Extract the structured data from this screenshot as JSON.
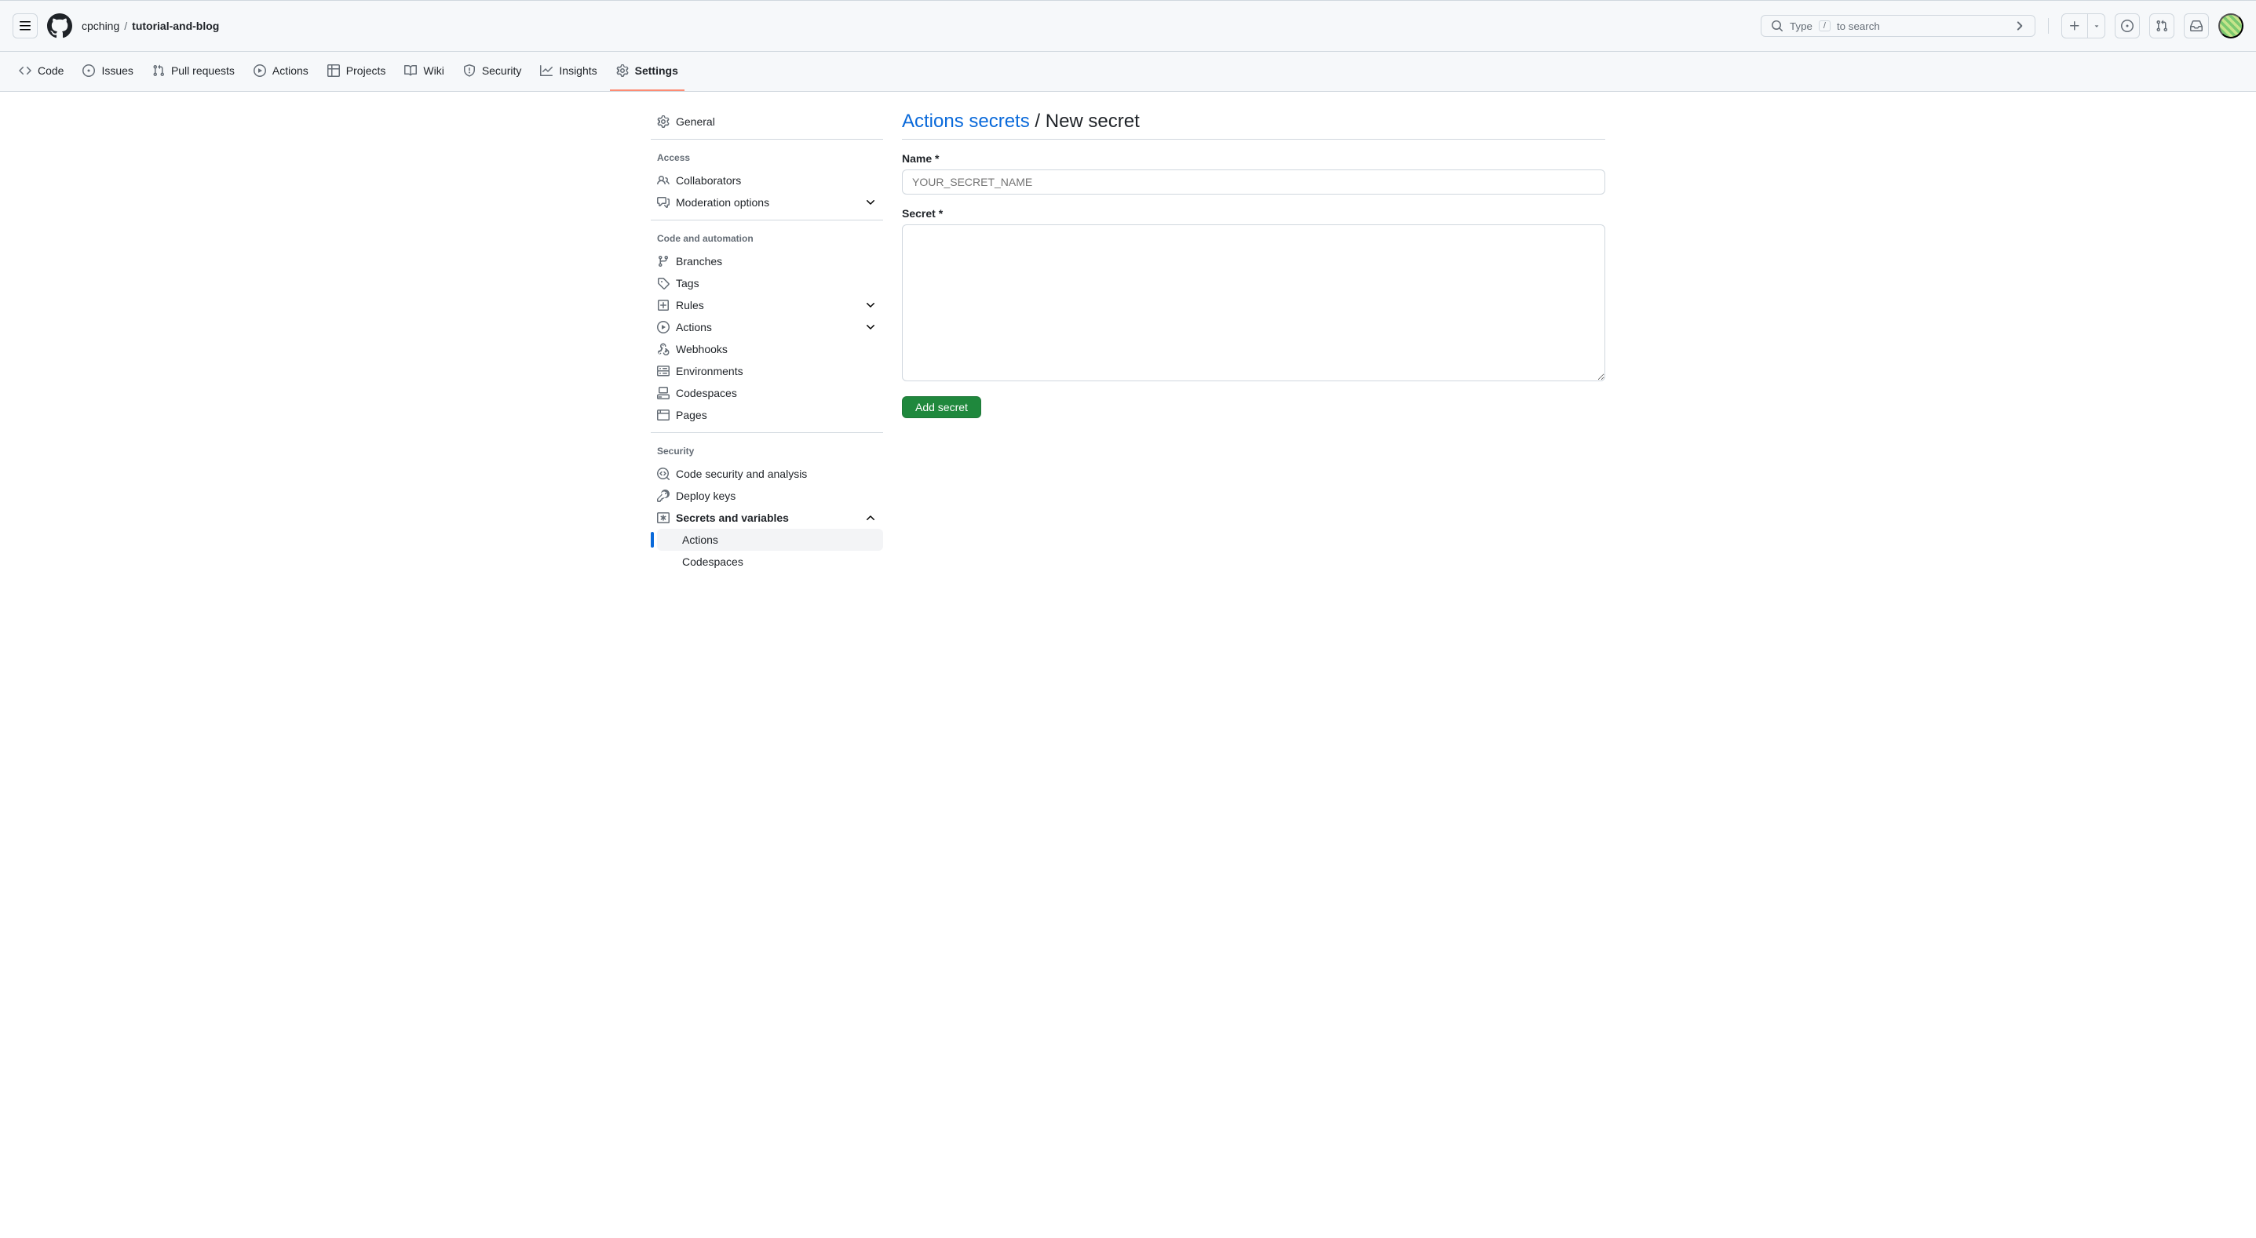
{
  "header": {
    "owner": "cpching",
    "repo": "tutorial-and-blog",
    "search_prompt_prefix": "Type ",
    "search_prompt_suffix": " to search",
    "slash_key": "/"
  },
  "repo_nav": [
    {
      "label": "Code"
    },
    {
      "label": "Issues"
    },
    {
      "label": "Pull requests"
    },
    {
      "label": "Actions"
    },
    {
      "label": "Projects"
    },
    {
      "label": "Wiki"
    },
    {
      "label": "Security"
    },
    {
      "label": "Insights"
    },
    {
      "label": "Settings"
    }
  ],
  "sidebar": {
    "general": "General",
    "groups": {
      "access": {
        "title": "Access",
        "collaborators": "Collaborators",
        "moderation": "Moderation options"
      },
      "code_automation": {
        "title": "Code and automation",
        "branches": "Branches",
        "tags": "Tags",
        "rules": "Rules",
        "actions": "Actions",
        "webhooks": "Webhooks",
        "environments": "Environments",
        "codespaces": "Codespaces",
        "pages": "Pages"
      },
      "security": {
        "title": "Security",
        "code_security": "Code security and analysis",
        "deploy_keys": "Deploy keys",
        "secrets_vars": "Secrets and variables",
        "sub_actions": "Actions",
        "sub_codespaces": "Codespaces"
      }
    }
  },
  "page": {
    "breadcrumb_link": "Actions secrets",
    "breadcrumb_sep": " / ",
    "breadcrumb_current": "New secret",
    "name_label": "Name *",
    "name_placeholder": "YOUR_SECRET_NAME",
    "secret_label": "Secret *",
    "submit_label": "Add secret"
  }
}
